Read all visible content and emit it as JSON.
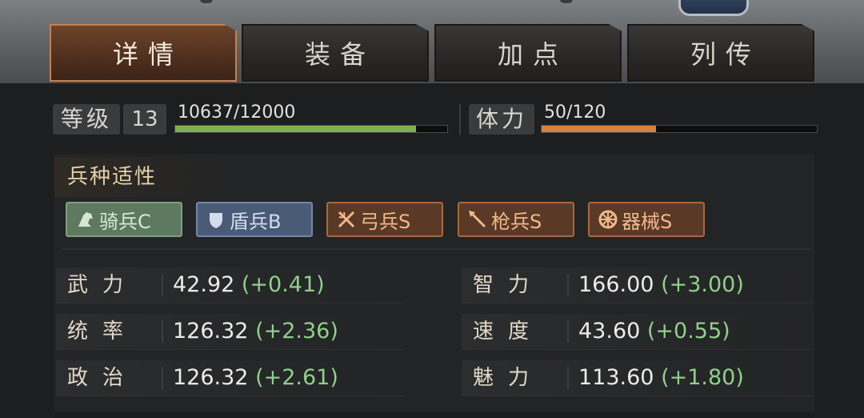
{
  "tabs": [
    {
      "label": "详情",
      "active": true
    },
    {
      "label": "装备",
      "active": false
    },
    {
      "label": "加点",
      "active": false
    },
    {
      "label": "列传",
      "active": false
    }
  ],
  "level": {
    "label": "等级",
    "value": "13",
    "exp_text": "10637/12000",
    "exp_fraction": 0.8864,
    "bar_color": "#7fb04f"
  },
  "stamina": {
    "label": "体力",
    "value_text": "50/120",
    "fraction": 0.4167,
    "bar_color": "#d8813c"
  },
  "aptitude": {
    "title": "兵种适性",
    "items": [
      {
        "label": "骑兵C",
        "icon": "horse-icon",
        "bg": "#5d7a60",
        "border": "#7fa07f",
        "color": "#d4e8d0"
      },
      {
        "label": "盾兵B",
        "icon": "shield-icon",
        "bg": "#4a5b78",
        "border": "#7288ad",
        "color": "#d2dcec"
      },
      {
        "label": "弓兵S",
        "icon": "bow-icon",
        "bg": "#5a3a26",
        "border": "#a8683e",
        "color": "#f0b98c"
      },
      {
        "label": "枪兵S",
        "icon": "spear-icon",
        "bg": "#5a3a26",
        "border": "#a8683e",
        "color": "#f0b98c"
      },
      {
        "label": "器械S",
        "icon": "wheel-icon",
        "bg": "#5a3a26",
        "border": "#a8683e",
        "color": "#f0b98c"
      }
    ]
  },
  "stats": {
    "left": [
      {
        "label": "武力",
        "value": "42.92",
        "bonus": "(+0.41)"
      },
      {
        "label": "统率",
        "value": "126.32",
        "bonus": "(+2.36)"
      },
      {
        "label": "政治",
        "value": "126.32",
        "bonus": "(+2.61)"
      }
    ],
    "right": [
      {
        "label": "智力",
        "value": "166.00",
        "bonus": "(+3.00)"
      },
      {
        "label": "速度",
        "value": "43.60",
        "bonus": "(+0.55)"
      },
      {
        "label": "魅力",
        "value": "113.60",
        "bonus": "(+1.80)"
      }
    ]
  }
}
